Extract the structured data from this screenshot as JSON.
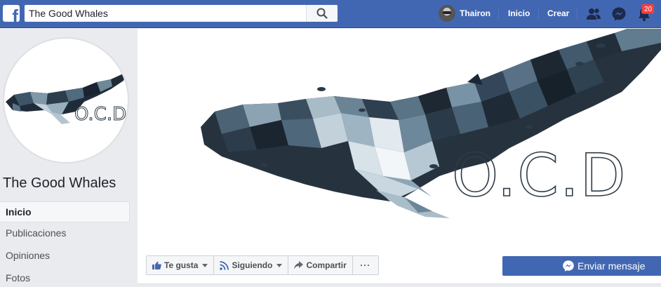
{
  "topbar": {
    "search_value": "The Good Whales",
    "search_placeholder": "Buscar",
    "user_name": "Thairon",
    "nav_home": "Inicio",
    "nav_create": "Crear",
    "notification_count": "20",
    "colors": {
      "bar": "#4267b2",
      "badge": "#fa3e3e"
    },
    "icons": [
      "facebook-logo-icon",
      "search-icon",
      "friends-icon",
      "messenger-icon",
      "bell-icon"
    ]
  },
  "page": {
    "name": "The Good Whales",
    "logo_text": "O.C.D"
  },
  "sidebar": {
    "items": [
      {
        "label": "Inicio",
        "active": true
      },
      {
        "label": "Publicaciones"
      },
      {
        "label": "Opiniones"
      },
      {
        "label": "Fotos"
      }
    ]
  },
  "actions": {
    "like_label": "Te gusta",
    "follow_label": "Siguiendo",
    "share_label": "Compartir",
    "more_label": "···",
    "message_label": "Enviar mensaje"
  }
}
